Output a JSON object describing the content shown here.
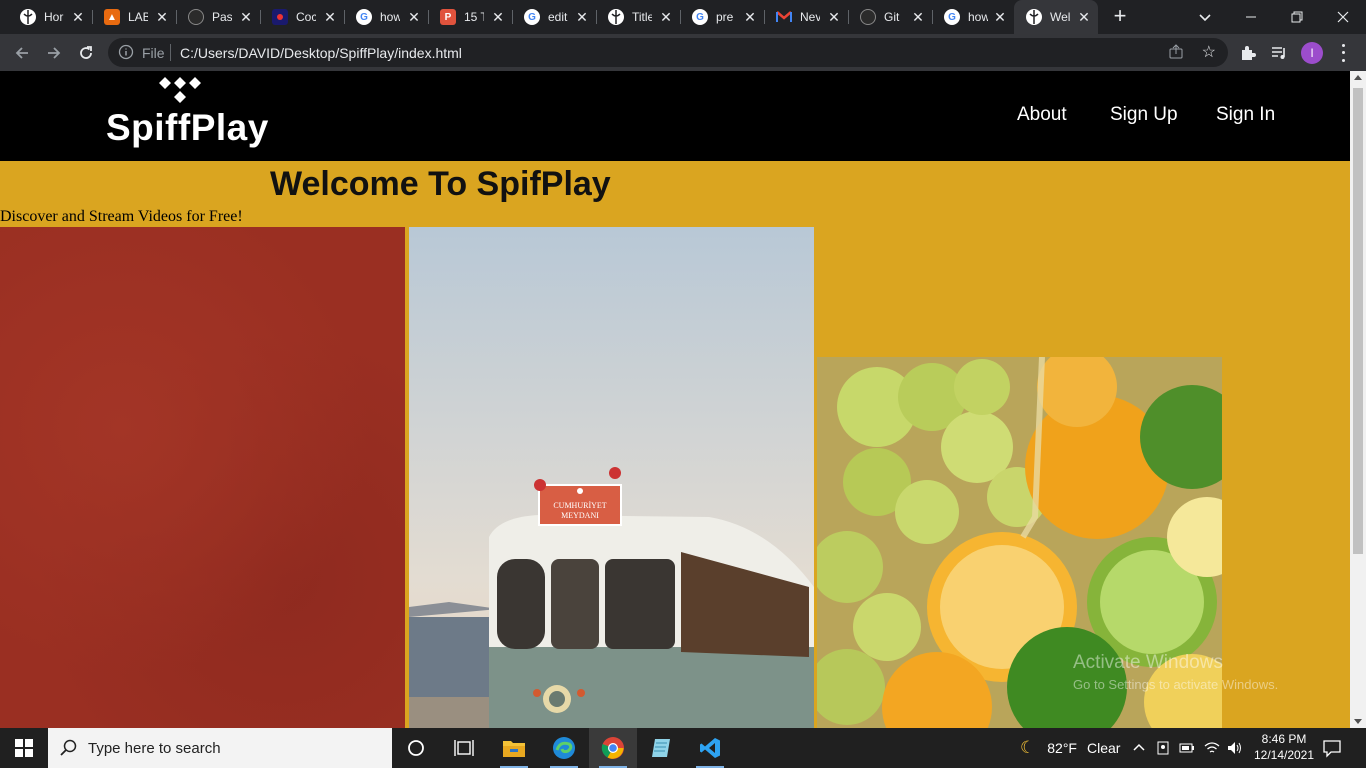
{
  "browser": {
    "tabs": [
      {
        "title": "Hor",
        "icon": "globe-icon",
        "color": "#ffffff"
      },
      {
        "title": "LAB",
        "icon": "lab-icon",
        "color": "#e86a10"
      },
      {
        "title": "Pas",
        "icon": "github-icon",
        "color": "#2b2b2b"
      },
      {
        "title": "Coc",
        "icon": "coc-icon",
        "color": "#1a1a6e"
      },
      {
        "title": "how",
        "icon": "google-icon",
        "color": "#ffffff"
      },
      {
        "title": "15 T",
        "icon": "p-icon",
        "color": "#e0533d"
      },
      {
        "title": "edit",
        "icon": "google-icon",
        "color": "#ffffff"
      },
      {
        "title": "Title",
        "icon": "globe-icon",
        "color": "#ffffff"
      },
      {
        "title": "pre",
        "icon": "google-icon",
        "color": "#ffffff"
      },
      {
        "title": "Nev",
        "icon": "gmail-icon",
        "color": "#ffffff"
      },
      {
        "title": "Git",
        "icon": "github-icon",
        "color": "#2b2b2b"
      },
      {
        "title": "how",
        "icon": "google-icon",
        "color": "#ffffff"
      },
      {
        "title": "Wel",
        "icon": "globe-icon",
        "color": "#ffffff",
        "active": true
      }
    ],
    "address": {
      "scheme_label": "File",
      "url": "C:/Users/DAVID/Desktop/SpiffPlay/index.html"
    },
    "profile_initial": "I"
  },
  "site": {
    "logo_text": "SpiffPlay",
    "nav": [
      "About",
      "Sign Up",
      "Sign In"
    ],
    "heading": "Welcome To SpifPlay",
    "tagline": "Discover and Stream Videos for Free!",
    "tram_sign_line1": "CUMHURİYET",
    "tram_sign_line2": "MEYDANI",
    "colors": {
      "header_bg": "#000000",
      "page_bg": "#DAA520",
      "red_panel": "#9a2f22"
    }
  },
  "watermark": {
    "title": "Activate Windows",
    "subtitle": "Go to Settings to activate Windows."
  },
  "taskbar": {
    "search_placeholder": "Type here to search",
    "weather_temp": "82°F",
    "weather_text": "Clear",
    "time": "8:46 PM",
    "date": "12/14/2021"
  }
}
